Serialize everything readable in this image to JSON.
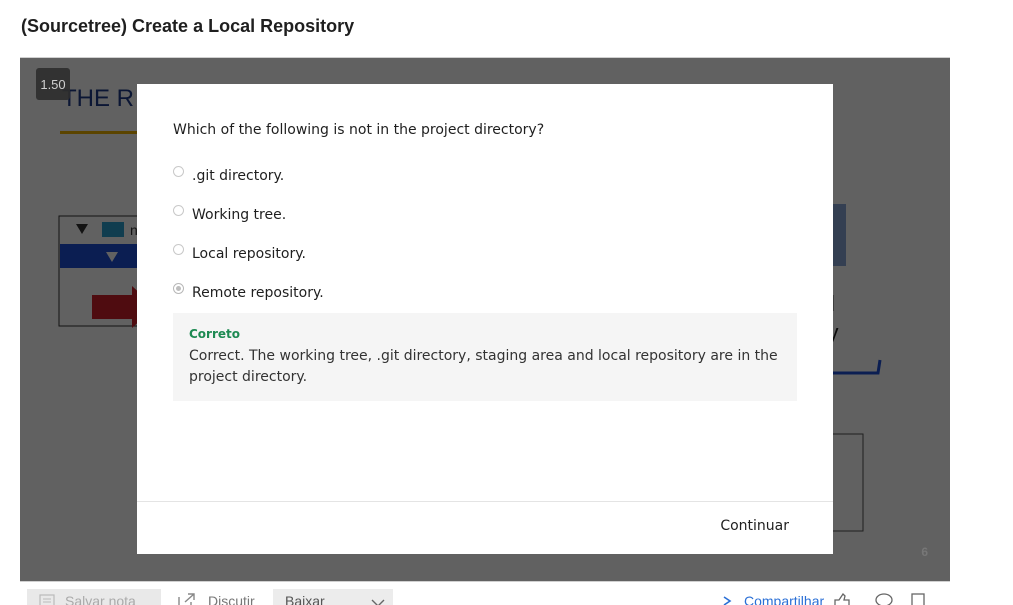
{
  "page": {
    "title": "(Sourcetree) Create a Local Repository"
  },
  "player": {
    "speed": "1.50",
    "slide_number": "6",
    "slide_fragments": {
      "heading": "THE R",
      "tree_item": "n",
      "side_text_1": "l",
      "side_text_2": "ory"
    }
  },
  "quiz": {
    "question": "Which of the following is not in the project directory?",
    "options": [
      {
        "label": ".git directory.",
        "selected": false
      },
      {
        "label": "Working tree.",
        "selected": false
      },
      {
        "label": "Local repository.",
        "selected": false
      },
      {
        "label": "Remote repository.",
        "selected": true
      }
    ],
    "feedback": {
      "title": "Correto",
      "text": "Correct. The working tree, .git directory, staging area and local repository are in the project directory."
    },
    "continue_label": "Continuar"
  },
  "toolbar": {
    "save_note_label": "Salvar nota",
    "discuss_label": "Discutir",
    "download_label": "Baixar",
    "share_label": "Compartilhar"
  },
  "colors": {
    "feedback_title": "#1d8a52",
    "share_link": "#2a6fd6",
    "overlay": "#000000"
  }
}
